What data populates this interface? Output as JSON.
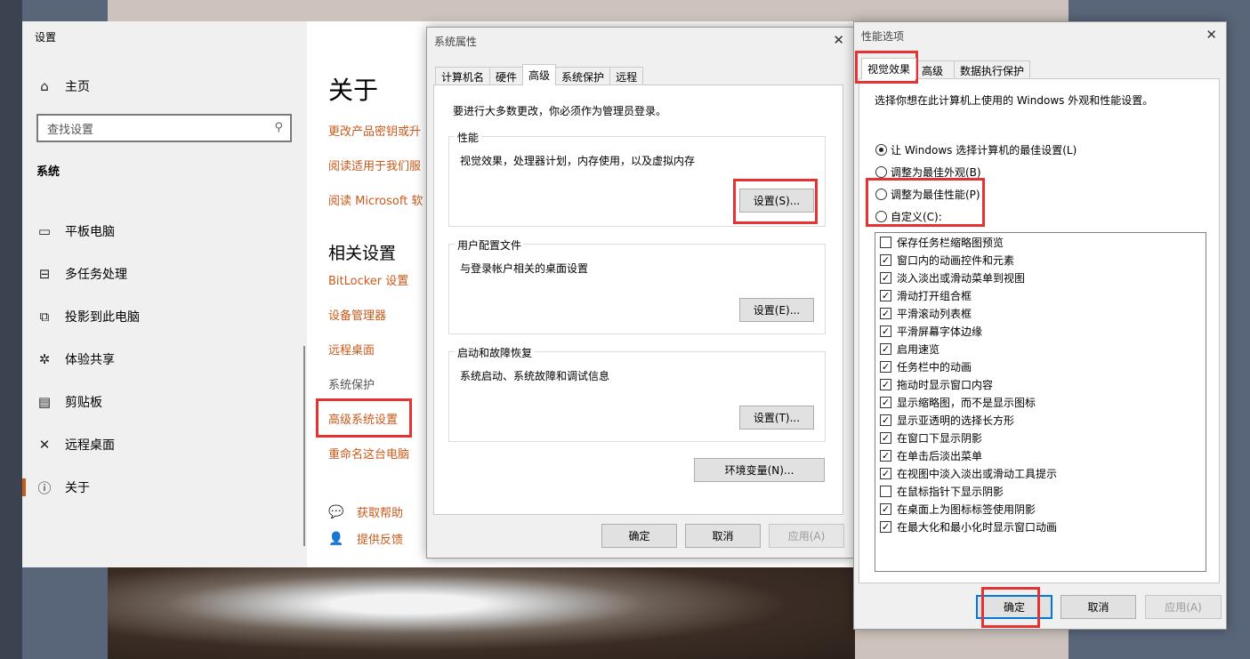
{
  "settings": {
    "window_title": "设置",
    "home_label": "主页",
    "search_placeholder": "查找设置",
    "section_label": "系统",
    "nav_items": [
      {
        "label": "平板电脑",
        "icon": "tablet-icon"
      },
      {
        "label": "多任务处理",
        "icon": "multitask-icon"
      },
      {
        "label": "投影到此电脑",
        "icon": "project-icon"
      },
      {
        "label": "体验共享",
        "icon": "share-icon"
      },
      {
        "label": "剪贴板",
        "icon": "clipboard-icon"
      },
      {
        "label": "远程桌面",
        "icon": "remote-icon"
      },
      {
        "label": "关于",
        "icon": "info-icon",
        "active": true
      }
    ],
    "about_title": "关于",
    "links_top": [
      "更改产品密钥或升",
      "阅读适用于我们服",
      "阅读 Microsoft 软"
    ],
    "related_title": "相关设置",
    "related_links": [
      "BitLocker 设置",
      "设备管理器",
      "远程桌面",
      "系统保护",
      "高级系统设置",
      "重命名这台电脑"
    ],
    "help_label": "获取帮助",
    "feedback_label": "提供反馈"
  },
  "sysprops": {
    "title": "系统属性",
    "tabs": [
      "计算机名",
      "硬件",
      "高级",
      "系统保护",
      "远程"
    ],
    "selected_tab": "高级",
    "admin_note": "要进行大多数更改，你必须作为管理员登录。",
    "perf_label": "性能",
    "perf_desc": "视觉效果，处理器计划，内存使用，以及虚拟内存",
    "perf_button": "设置(S)...",
    "profile_label": "用户配置文件",
    "profile_desc": "与登录帐户相关的桌面设置",
    "profile_button": "设置(E)...",
    "startup_label": "启动和故障恢复",
    "startup_desc": "系统启动、系统故障和调试信息",
    "startup_button": "设置(T)...",
    "env_button": "环境变量(N)...",
    "ok": "确定",
    "cancel": "取消",
    "apply": "应用(A)"
  },
  "perfopts": {
    "title": "性能选项",
    "tabs": [
      "视觉效果",
      "高级",
      "数据执行保护"
    ],
    "selected_tab": "视觉效果",
    "intro": "选择你想在此计算机上使用的 Windows 外观和性能设置。",
    "radios": [
      {
        "label": "让 Windows 选择计算机的最佳设置(L)",
        "checked": true
      },
      {
        "label": "调整为最佳外观(B)",
        "checked": false
      },
      {
        "label": "调整为最佳性能(P)",
        "checked": false
      },
      {
        "label": "自定义(C):",
        "checked": false
      }
    ],
    "checks": [
      {
        "label": "保存任务栏缩略图预览",
        "checked": false
      },
      {
        "label": "窗口内的动画控件和元素",
        "checked": true
      },
      {
        "label": "淡入淡出或滑动菜单到视图",
        "checked": true
      },
      {
        "label": "滑动打开组合框",
        "checked": true
      },
      {
        "label": "平滑滚动列表框",
        "checked": true
      },
      {
        "label": "平滑屏幕字体边缘",
        "checked": true
      },
      {
        "label": "启用速览",
        "checked": true
      },
      {
        "label": "任务栏中的动画",
        "checked": true
      },
      {
        "label": "拖动时显示窗口内容",
        "checked": true
      },
      {
        "label": "显示缩略图，而不是显示图标",
        "checked": true
      },
      {
        "label": "显示亚透明的选择长方形",
        "checked": true
      },
      {
        "label": "在窗口下显示阴影",
        "checked": true
      },
      {
        "label": "在单击后淡出菜单",
        "checked": true
      },
      {
        "label": "在视图中淡入淡出或滑动工具提示",
        "checked": true
      },
      {
        "label": "在鼠标指针下显示阴影",
        "checked": false
      },
      {
        "label": "在桌面上为图标标签使用阴影",
        "checked": true
      },
      {
        "label": "在最大化和最小化时显示窗口动画",
        "checked": true
      }
    ],
    "ok": "确定",
    "cancel": "取消",
    "apply": "应用(A)"
  },
  "colors": {
    "accent_link": "#c85a1a",
    "highlight": "#e53333",
    "focus": "#0078d7"
  }
}
